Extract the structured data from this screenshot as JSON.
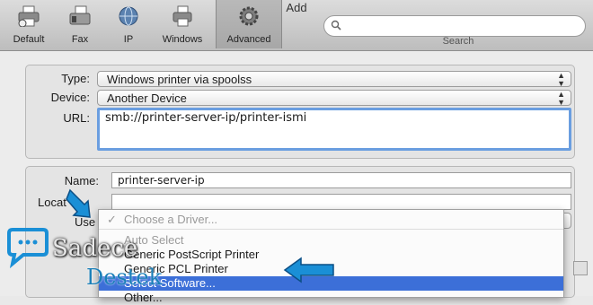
{
  "window": {
    "title": "Add"
  },
  "toolbar": {
    "items": [
      {
        "label": "Default",
        "icon": "printer-icon"
      },
      {
        "label": "Fax",
        "icon": "fax-icon"
      },
      {
        "label": "IP",
        "icon": "globe-icon"
      },
      {
        "label": "Windows",
        "icon": "windows-printer-icon"
      },
      {
        "label": "Advanced",
        "icon": "gear-icon",
        "selected": true
      }
    ],
    "search_caption": "Search"
  },
  "form": {
    "type_label": "Type:",
    "type_value": "Windows printer via spoolss",
    "device_label": "Device:",
    "device_value": "Another Device",
    "url_label": "URL:",
    "url_value": "smb://printer-server-ip/printer-ismi",
    "name_label": "Name:",
    "name_value": "printer-server-ip",
    "location_label": "Locat",
    "use_label": "Use"
  },
  "driver_menu": {
    "items": [
      {
        "label": "Choose a Driver...",
        "checked": true,
        "disabled": true
      },
      {
        "label": "Auto Select",
        "disabled": true
      },
      {
        "label": "Generic PostScript Printer"
      },
      {
        "label": "Generic PCL Printer"
      },
      {
        "label": "Select Software...",
        "highlighted": true
      },
      {
        "label": "Other..."
      }
    ]
  },
  "watermark": {
    "line1": "Sadece",
    "line2": "Destek"
  },
  "colors": {
    "highlight": "#3c6fd8",
    "focus_ring": "#6a9ee0",
    "arrow": "#1a8fd6"
  }
}
